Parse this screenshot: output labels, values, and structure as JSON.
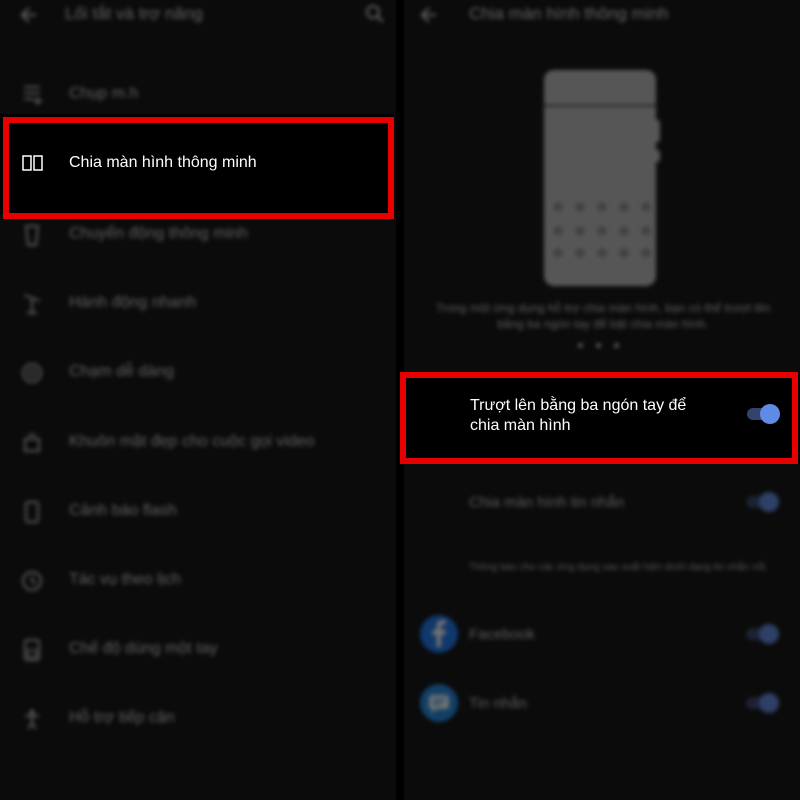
{
  "left_panel": {
    "title": "Lối tắt và trợ năng",
    "items": [
      {
        "label": "Chụp m.h",
        "icon": "screenshot-icon"
      },
      {
        "label": "Chia màn hình thông minh",
        "icon": "split-screen-icon",
        "highlighted": true
      },
      {
        "label": "Chuyển động thông minh",
        "icon": "smart-motion-icon"
      },
      {
        "label": "Hành động nhanh",
        "icon": "quick-action-icon"
      },
      {
        "label": "Chạm dễ dàng",
        "icon": "easy-touch-icon"
      },
      {
        "label": "Khuôn mặt đẹp cho cuộc gọi video",
        "icon": "face-beauty-icon"
      },
      {
        "label": "Cảnh báo flash",
        "icon": "flash-alert-icon"
      },
      {
        "label": "Tác vụ theo lịch",
        "icon": "schedule-icon"
      },
      {
        "label": "Chế độ dùng một tay",
        "icon": "one-hand-icon"
      },
      {
        "label": "Hỗ trợ tiếp cận",
        "icon": "accessibility-icon"
      }
    ]
  },
  "right_panel": {
    "title": "Chia màn hình thông minh",
    "description": "Trong một ứng dụng hỗ trợ chia màn hình, bạn có thể trượt lên bằng ba ngón tay để bật chia màn hình.",
    "swipe_toggle": {
      "label": "Trượt lên bằng ba ngón tay để chia màn hình",
      "enabled": true
    },
    "message_toggle": {
      "label": "Chia màn hình tin nhắn",
      "enabled": true
    },
    "note": "Thông báo cho các ứng dụng sau xuất hiện dưới dạng tin nhắn nổi.",
    "apps": [
      {
        "label": "Facebook",
        "icon": "facebook-icon",
        "enabled": true
      },
      {
        "label": "Tin nhắn",
        "icon": "messages-icon",
        "enabled": true
      }
    ]
  },
  "colors": {
    "highlight": "#e60000",
    "toggle_thumb": "#5f8ae6",
    "toggle_track": "#33436b",
    "facebook": "#1877f2",
    "messages": "#1e88e5"
  }
}
